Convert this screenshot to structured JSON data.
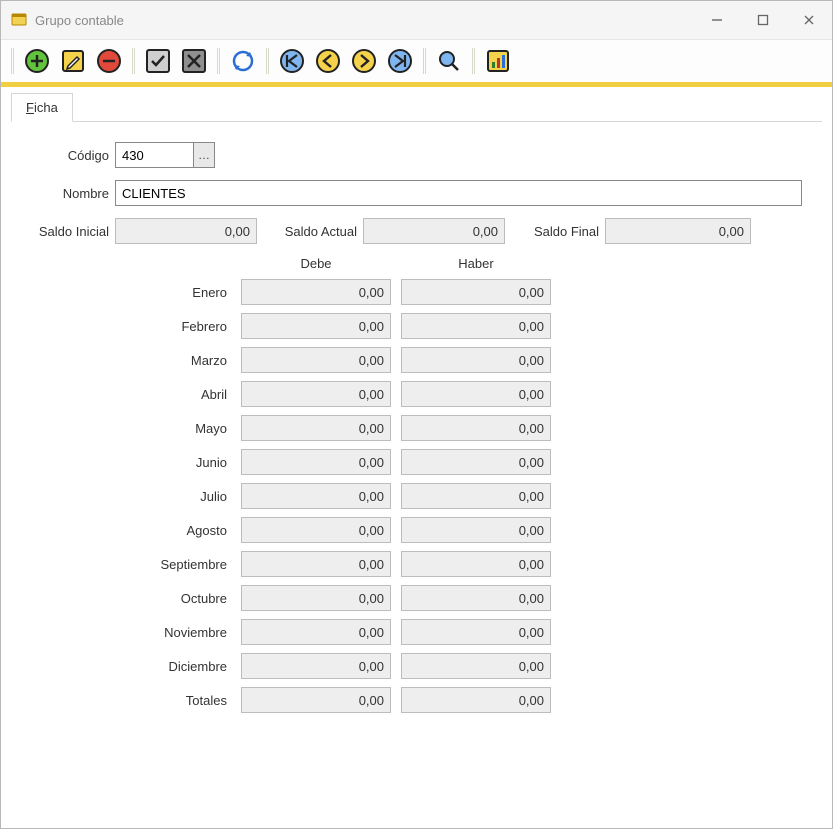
{
  "window": {
    "title": "Grupo contable"
  },
  "tabs": {
    "ficha_prefix": "F",
    "ficha_rest": "icha"
  },
  "labels": {
    "codigo": "Código",
    "nombre": "Nombre",
    "saldo_inicial": "Saldo Inicial",
    "saldo_actual": "Saldo Actual",
    "saldo_final": "Saldo Final",
    "debe": "Debe",
    "haber": "Haber"
  },
  "fields": {
    "codigo": "430",
    "nombre": "CLIENTES",
    "saldo_inicial": "0,00",
    "saldo_actual": "0,00",
    "saldo_final": "0,00"
  },
  "months": [
    {
      "label": "Enero",
      "debe": "0,00",
      "haber": "0,00"
    },
    {
      "label": "Febrero",
      "debe": "0,00",
      "haber": "0,00"
    },
    {
      "label": "Marzo",
      "debe": "0,00",
      "haber": "0,00"
    },
    {
      "label": "Abril",
      "debe": "0,00",
      "haber": "0,00"
    },
    {
      "label": "Mayo",
      "debe": "0,00",
      "haber": "0,00"
    },
    {
      "label": "Junio",
      "debe": "0,00",
      "haber": "0,00"
    },
    {
      "label": "Julio",
      "debe": "0,00",
      "haber": "0,00"
    },
    {
      "label": "Agosto",
      "debe": "0,00",
      "haber": "0,00"
    },
    {
      "label": "Septiembre",
      "debe": "0,00",
      "haber": "0,00"
    },
    {
      "label": "Octubre",
      "debe": "0,00",
      "haber": "0,00"
    },
    {
      "label": "Noviembre",
      "debe": "0,00",
      "haber": "0,00"
    },
    {
      "label": "Diciembre",
      "debe": "0,00",
      "haber": "0,00"
    },
    {
      "label": "Totales",
      "debe": "0,00",
      "haber": "0,00"
    }
  ],
  "toolbar": {
    "icons": [
      "add",
      "edit",
      "delete",
      "accept",
      "cancel",
      "refresh",
      "first",
      "prev",
      "next",
      "last",
      "search",
      "chart"
    ]
  }
}
